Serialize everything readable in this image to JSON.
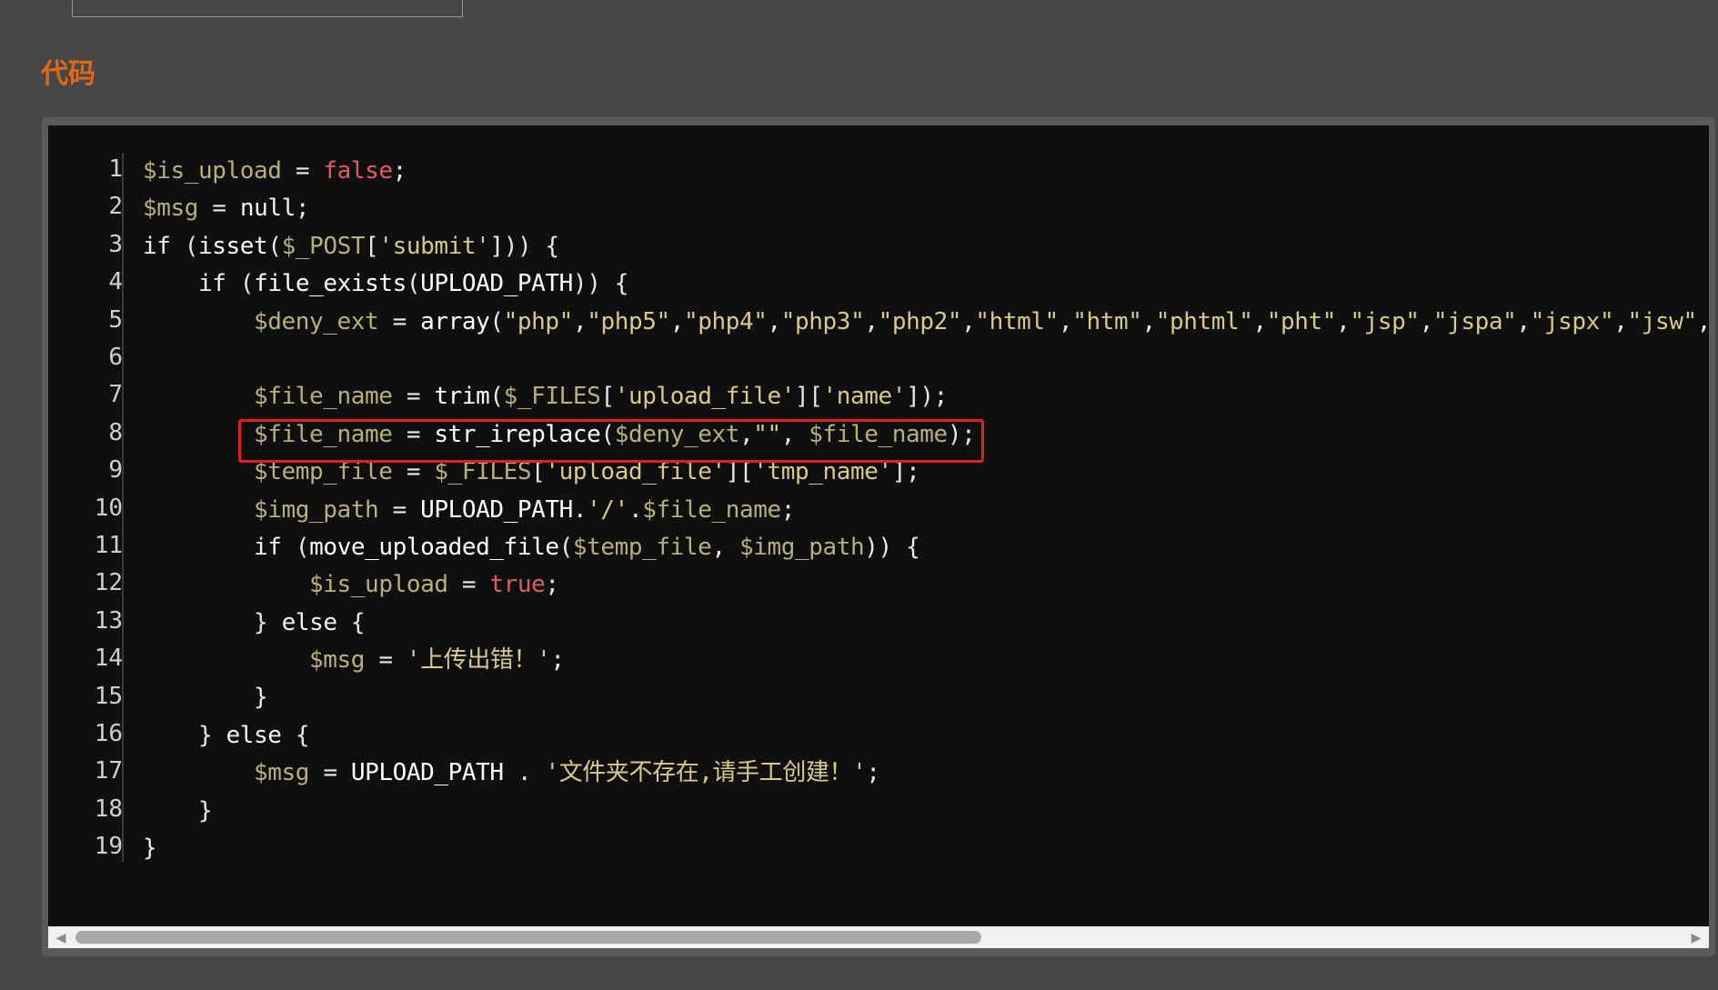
{
  "section": {
    "title": "代码"
  },
  "code": {
    "line_numbers": [
      "1",
      "2",
      "3",
      "4",
      "5",
      "6",
      "7",
      "8",
      "9",
      "10",
      "11",
      "12",
      "13",
      "14",
      "15",
      "16",
      "17",
      "18",
      "19"
    ],
    "lines": [
      "$is_upload = false;",
      "$msg = null;",
      "if (isset($_POST['submit'])) {",
      "    if (file_exists(UPLOAD_PATH)) {",
      "        $deny_ext = array(\"php\",\"php5\",\"php4\",\"php3\",\"php2\",\"html\",\"htm\",\"phtml\",\"pht\",\"jsp\",\"jspa\",\"jspx\",\"jsw\",",
      "",
      "        $file_name = trim($_FILES['upload_file']['name']);",
      "        $file_name = str_ireplace($deny_ext,\"\", $file_name);",
      "        $temp_file = $_FILES['upload_file']['tmp_name'];",
      "        $img_path = UPLOAD_PATH.'/'.$file_name;",
      "        if (move_uploaded_file($temp_file, $img_path)) {",
      "            $is_upload = true;",
      "        } else {",
      "            $msg = '上传出错！';",
      "        }",
      "    } else {",
      "        $msg = UPLOAD_PATH . '文件夹不存在,请手工创建！';",
      "    }",
      "}"
    ]
  },
  "colors": {
    "page_bg": "#474747",
    "code_bg": "#0f0f0f",
    "title": "#e0681a",
    "highlight": "#e0201e",
    "variable": "#b8b07a",
    "keyword_boolean": "#e05d5d"
  },
  "scrollbar": {
    "left_arrow_icon": "◀",
    "right_arrow_icon": "▶"
  }
}
